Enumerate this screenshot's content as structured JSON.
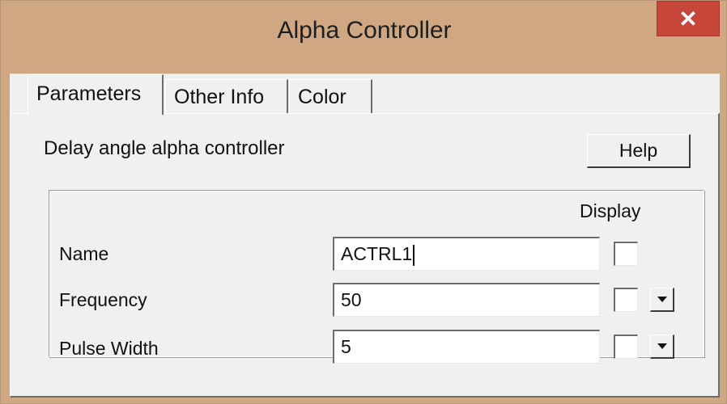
{
  "window": {
    "title": "Alpha Controller",
    "close_icon": "close-icon",
    "accent_close": "#c7463a",
    "frame_color": "#cfa883"
  },
  "tabs": [
    {
      "label": "Parameters",
      "active": true
    },
    {
      "label": "Other Info",
      "active": false
    },
    {
      "label": "Color",
      "active": false
    }
  ],
  "description": "Delay angle alpha controller",
  "help_label": "Help",
  "display_header": "Display",
  "rows": [
    {
      "label": "Name",
      "value": "ACTRL1",
      "display_checked": false,
      "has_dropdown": false
    },
    {
      "label": "Frequency",
      "value": "50",
      "display_checked": false,
      "has_dropdown": true
    },
    {
      "label": "Pulse Width",
      "value": "5",
      "display_checked": false,
      "has_dropdown": true
    }
  ]
}
